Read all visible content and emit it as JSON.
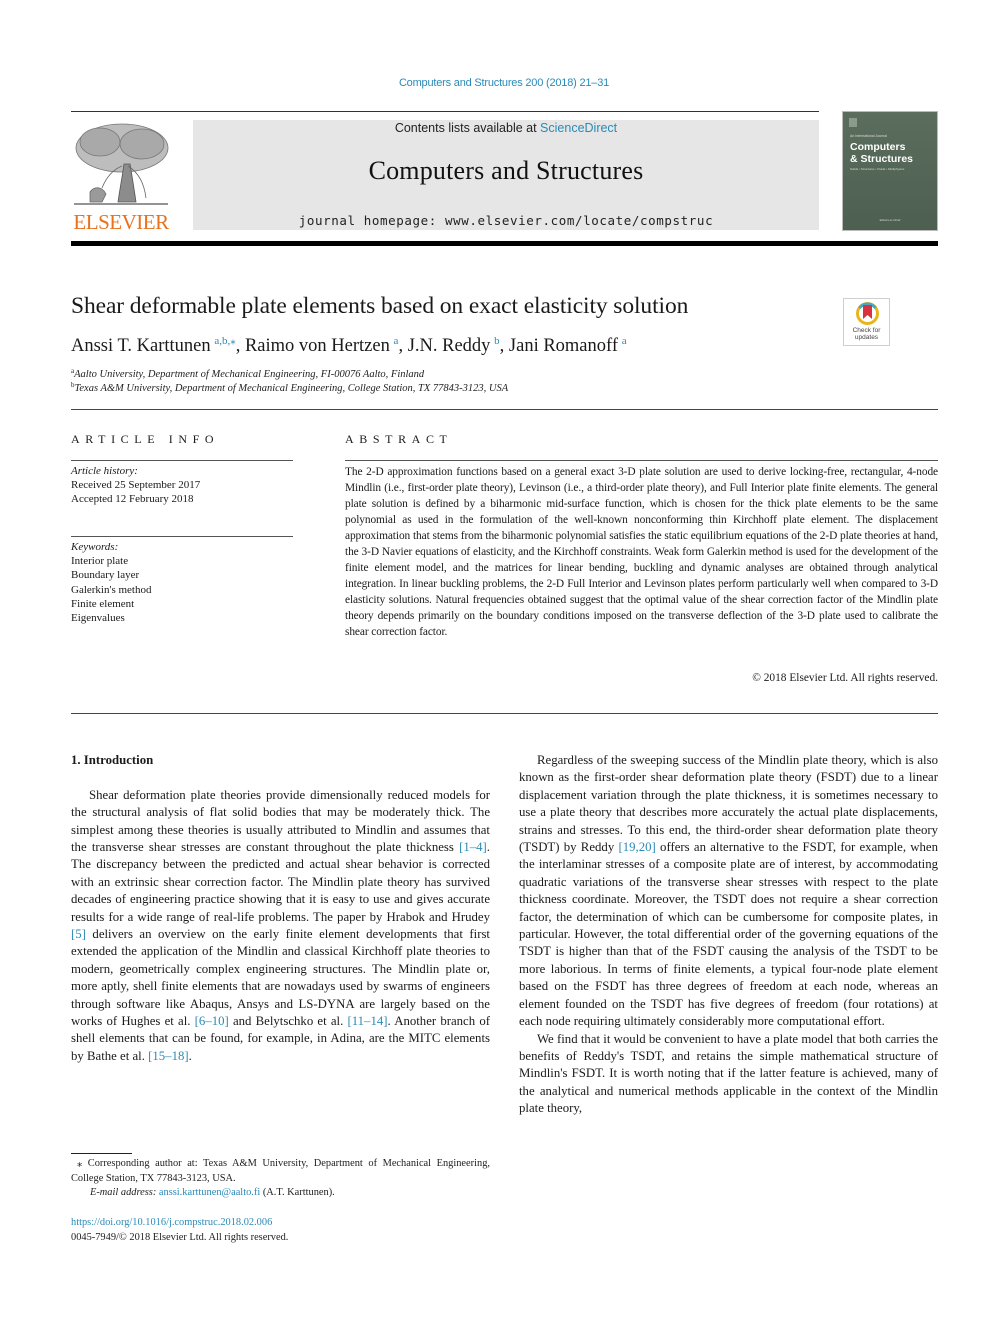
{
  "running_head": "Computers and Structures 200 (2018) 21–31",
  "masthead": {
    "contents_prefix": "Contents lists available at ",
    "contents_link": "ScienceDirect",
    "journal_name": "Computers and Structures",
    "homepage": "journal homepage: www.elsevier.com/locate/compstruc"
  },
  "publisher_logo": {
    "wordmark": "ELSEVIER",
    "color": "#e9711c"
  },
  "cover": {
    "kicker": "An International Journal",
    "title_line1": "Computers",
    "title_line2": "& Structures",
    "subtitle": "Solids • Structures • Fluids • Multiphysics",
    "footer": "Editors-in-Chief"
  },
  "crossmark": {
    "line1": "Check for",
    "line2": "updates"
  },
  "article": {
    "title": "Shear deformable plate elements based on exact elasticity solution",
    "authors": [
      {
        "name": "Anssi T. Karttunen",
        "affil": "a,b,⁎",
        "sep": ", "
      },
      {
        "name": "Raimo von Hertzen",
        "affil": "a",
        "sep": ", "
      },
      {
        "name": "J.N. Reddy",
        "affil": "b",
        "sep": ", "
      },
      {
        "name": "Jani Romanoff",
        "affil": "a",
        "sep": ""
      }
    ],
    "affiliations": [
      {
        "mark": "a",
        "text": "Aalto University, Department of Mechanical Engineering, FI-00076 Aalto, Finland"
      },
      {
        "mark": "b",
        "text": "Texas A&M University, Department of Mechanical Engineering, College Station, TX 77843-3123, USA"
      }
    ]
  },
  "article_info": {
    "label": "ARTICLE INFO",
    "history_head": "Article history:",
    "received": "Received 25 September 2017",
    "accepted": "Accepted 12 February 2018",
    "keywords_head": "Keywords:",
    "keywords": [
      "Interior plate",
      "Boundary layer",
      "Galerkin's method",
      "Finite element",
      "Eigenvalues"
    ]
  },
  "abstract": {
    "label": "ABSTRACT",
    "text": "The 2-D approximation functions based on a general exact 3-D plate solution are used to derive locking-free, rectangular, 4-node Mindlin (i.e., first-order plate theory), Levinson (i.e., a third-order plate theory), and Full Interior plate finite elements. The general plate solution is defined by a biharmonic mid-surface function, which is chosen for the thick plate elements to be the same polynomial as used in the formulation of the well-known nonconforming thin Kirchhoff plate element. The displacement approximation that stems from the biharmonic polynomial satisfies the static equilibrium equations of the 2-D plate theories at hand, the 3-D Navier equations of elasticity, and the Kirchhoff constraints. Weak form Galerkin method is used for the development of the finite element model, and the matrices for linear bending, buckling and dynamic analyses are obtained through analytical integration. In linear buckling problems, the 2-D Full Interior and Levinson plates perform particularly well when compared to 3-D elasticity solutions. Natural frequencies obtained suggest that the optimal value of the shear correction factor of the Mindlin plate theory depends primarily on the boundary conditions imposed on the transverse deflection of the 3-D plate used to calibrate the shear correction factor.",
    "copyright": "© 2018 Elsevier Ltd. All rights reserved."
  },
  "body": {
    "section_heading": "1. Introduction",
    "p1": {
      "t1": "Shear deformation plate theories provide dimensionally reduced models for the structural analysis of flat solid bodies that may be moderately thick. The simplest among these theories is usually attributed to Mindlin and assumes that the transverse shear stresses are constant throughout the plate thickness ",
      "r1": "[1–4]",
      "t2": ". The discrepancy between the predicted and actual shear behavior is corrected with an extrinsic shear correction factor. The Mindlin plate theory has survived decades of engineering practice showing that it is easy to use and gives accurate results for a wide range of real-life problems. The paper by Hrabok and Hrudey ",
      "r2": "[5]",
      "t3": " delivers an overview on the early finite element developments that first extended the application of the Mindlin and classical Kirchhoff plate theories to modern, geometrically complex engineering structures. The Mindlin plate or, more aptly, shell finite elements that are nowadays used by swarms of engineers through software like Abaqus, Ansys and LS-DYNA are largely based on the works of Hughes et al. ",
      "r3": "[6–10]",
      "t4": " and Belytschko et al. ",
      "r4": "[11–14]",
      "t5": ". Another branch of shell elements that can be found, for example, in Adina, are the MITC elements by Bathe et al. ",
      "r5": "[15–18]",
      "t6": "."
    },
    "p2": {
      "t1": "Regardless of the sweeping success of the Mindlin plate theory, which is also known as the first-order shear deformation plate theory (FSDT) due to a linear displacement variation through the plate thickness, it is sometimes necessary to use a plate theory that describes more accurately the actual plate displacements, strains and stresses. To this end, the third-order shear deformation plate theory (TSDT) by Reddy ",
      "r1": "[19,20]",
      "t2": " offers an alternative to the FSDT, for example, when the interlaminar stresses of a composite plate are of interest, by accommodating quadratic variations of the transverse shear stresses with respect to the plate thickness coordinate. Moreover, the TSDT does not require a shear correction factor, the determination of which can be cumbersome for composite plates, in particular. However, the total differential order of the governing equations of the TSDT is higher than that of the FSDT causing the analysis of the TSDT to be more laborious. In terms of finite elements, a typical four-node plate element based on the FSDT has three degrees of freedom at each node, whereas an element founded on the TSDT has five degrees of freedom (four rotations) at each node requiring ultimately considerably more computational effort."
    },
    "p3": {
      "t1": "We find that it would be convenient to have a plate model that both carries the benefits of Reddy's TSDT, and retains the simple mathematical structure of Mindlin's FSDT. It is worth noting that if the latter feature is achieved, many of the analytical and numerical methods applicable in the context of the Mindlin plate theory,"
    }
  },
  "footnote": {
    "star": "⁎",
    "corresponding": " Corresponding author at: Texas A&M University, Department of Mechanical Engineering, College Station, TX 77843-3123, USA.",
    "email_label": "E-mail address: ",
    "email": "anssi.karttunen@aalto.fi",
    "email_suffix": " (A.T. Karttunen)."
  },
  "doi": "https://doi.org/10.1016/j.compstruc.2018.02.006",
  "issn_line": "0045-7949/© 2018 Elsevier Ltd. All rights reserved.",
  "colors": {
    "link": "#2a8ab7",
    "elsevier_orange": "#e9711c",
    "masthead_gray": "#e6e6e6",
    "cover_green": "#5b6d5d"
  }
}
